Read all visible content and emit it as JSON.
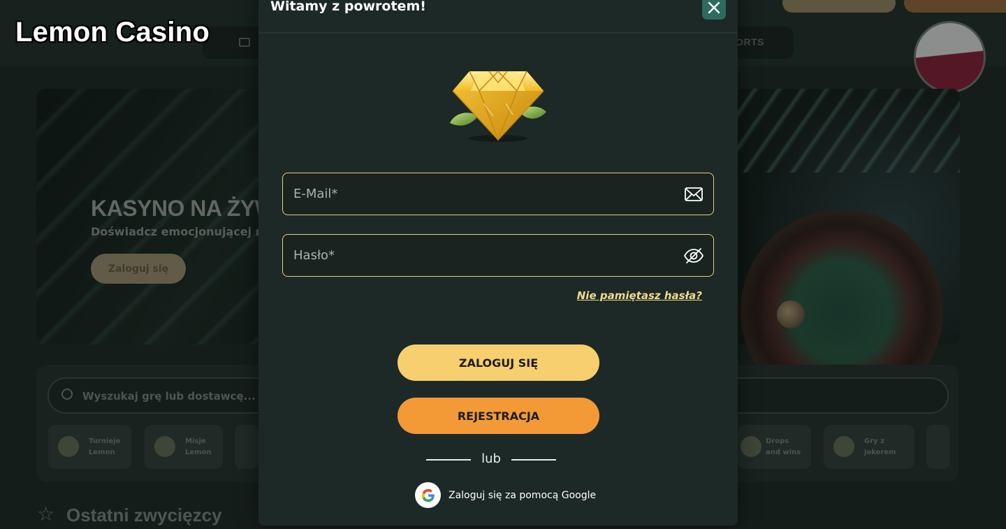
{
  "watermark": {
    "brand": "Lemon Casino"
  },
  "background": {
    "nav_text": "ORTS",
    "hero": {
      "title": "KASYNO NA ŻYW",
      "subtitle": "Doświadcz emocjonującej ro",
      "button": "Zaloguj się"
    },
    "search_placeholder": "Wyszukaj grę lub dostawcę...",
    "categories": [
      {
        "label": "Turnieje Lemon"
      },
      {
        "label": "Misje Lemon"
      },
      {
        "label": ""
      },
      {
        "label": "Drops and wins"
      },
      {
        "label": "Gry z jokerem"
      }
    ],
    "recent_winners": "Ostatni zwycięzcy"
  },
  "modal": {
    "title": "Witamy z powrotem!",
    "email_placeholder": "E-Mail*",
    "password_placeholder": "Hasło*",
    "forgot_password": "Nie pamiętasz hasła?",
    "login_button": "ZALOGUJ SIĘ",
    "register_button": "REJESTRACJA",
    "or_text": "lub",
    "google_login": "Zaloguj się za pomocą Google"
  },
  "colors": {
    "modal_bg": "#1c2926",
    "field_border": "#e6cf85",
    "login_button": "#f7cf6e",
    "register_button": "#f39a37",
    "close_button": "#2e6a5e",
    "link": "#f3d98c"
  },
  "icons": {
    "close": "close-icon",
    "email": "envelope-icon",
    "password": "eye-off-icon",
    "google": "google-icon",
    "gem": "diamond-icon"
  }
}
